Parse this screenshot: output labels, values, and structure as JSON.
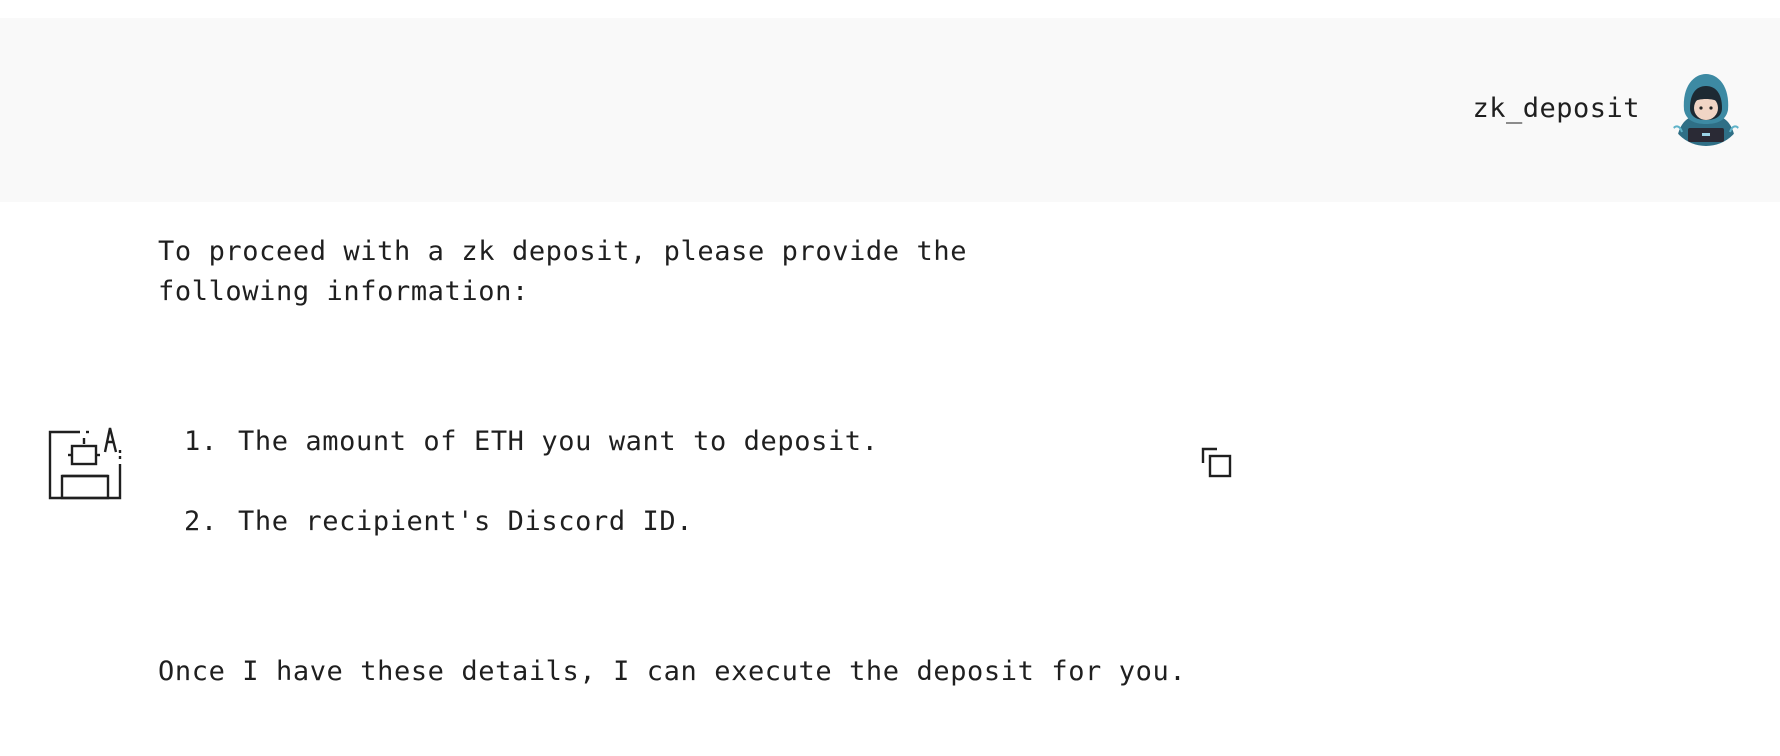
{
  "user": {
    "name": "zk_deposit",
    "avatar_icon": "hooded-character-avatar"
  },
  "assistant": {
    "avatar_icon": "robot-assistant-icon",
    "intro": "To proceed with a zk deposit, please provide the following information:",
    "items": [
      {
        "number": "1.",
        "text": "The amount of ETH you want to deposit."
      },
      {
        "number": "2.",
        "text": "The recipient's Discord ID."
      }
    ],
    "outro": "Once I have these details, I can execute the deposit for you."
  },
  "actions": {
    "copy_icon": "copy-icon"
  }
}
